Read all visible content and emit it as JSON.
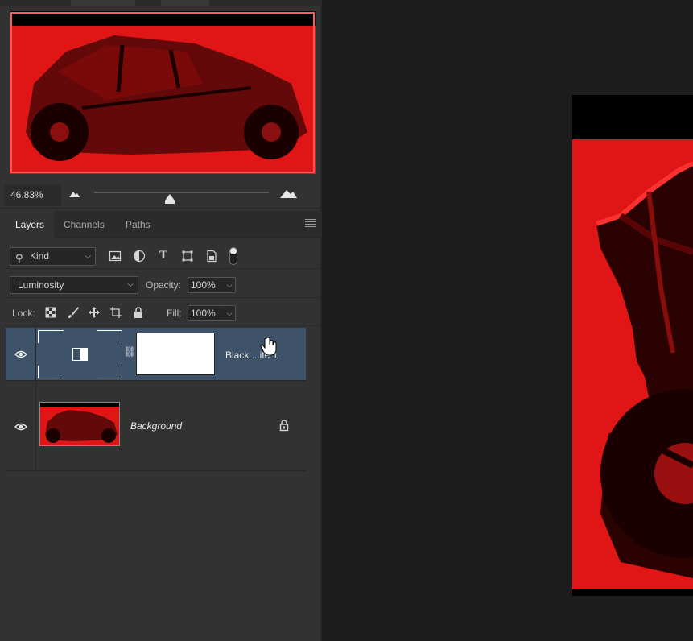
{
  "navigator": {
    "zoom_value": "46.83%",
    "zoom_slider_fraction": 0.41,
    "small_zoom_icon": "small-mountain-icon",
    "large_zoom_icon": "large-mountain-icon"
  },
  "tabs": [
    {
      "label": "Layers",
      "active": true
    },
    {
      "label": "Channels",
      "active": false
    },
    {
      "label": "Paths",
      "active": false
    }
  ],
  "filter": {
    "kind_label": "Kind",
    "icons": [
      "pixel-layer-filter-icon",
      "adjustment-layer-filter-icon",
      "type-layer-filter-icon",
      "shape-layer-filter-icon",
      "smart-object-filter-icon"
    ]
  },
  "blend": {
    "mode": "Luminosity",
    "opacity_label": "Opacity:",
    "opacity_value": "100%"
  },
  "lock": {
    "label": "Lock:",
    "fill_label": "Fill:",
    "fill_value": "100%",
    "icons": [
      "lock-transparent-pixels-icon",
      "lock-image-pixels-icon",
      "lock-position-icon",
      "lock-artboard-icon",
      "lock-all-icon"
    ]
  },
  "layers": [
    {
      "name": "Black ...ite 1",
      "selected": true,
      "type": "adjustment"
    },
    {
      "name": "Background",
      "selected": false,
      "type": "image",
      "locked": true
    }
  ],
  "colors": {
    "selection": "#3e5269",
    "image_red": "#e01515"
  }
}
